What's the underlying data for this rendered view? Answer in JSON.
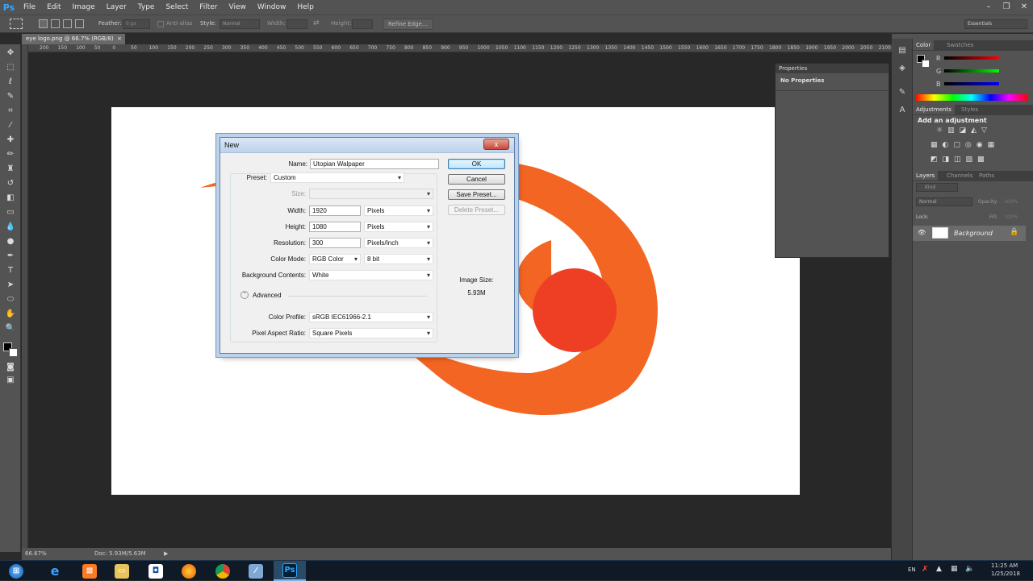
{
  "app": {
    "logo": "Ps",
    "window_buttons": [
      "–",
      "❐",
      "✕"
    ]
  },
  "menu": [
    "File",
    "Edit",
    "Image",
    "Layer",
    "Type",
    "Select",
    "Filter",
    "View",
    "Window",
    "Help"
  ],
  "options": {
    "feather_label": "Feather:",
    "feather_value": "0 px",
    "antialias_label": "Anti-alias",
    "style_label": "Style:",
    "style_value": "Normal",
    "width_label": "Width:",
    "height_label": "Height:",
    "refine_edge": "Refine Edge...",
    "workspace": "Essentials"
  },
  "document_tab": {
    "title": "eye logo.png @ 66.7% (RGB/8)",
    "close": "×"
  },
  "ruler_ticks": [
    "200",
    "150",
    "100",
    "50",
    "0",
    "50",
    "100",
    "150",
    "200",
    "250",
    "300",
    "350",
    "400",
    "450",
    "500",
    "550",
    "600",
    "650",
    "700",
    "750",
    "800",
    "850",
    "900",
    "950",
    "1000",
    "1050",
    "1100",
    "1150",
    "1200",
    "1250",
    "1300",
    "1350",
    "1400",
    "1450",
    "1500",
    "1550",
    "1600",
    "1650",
    "1700",
    "1750",
    "1800",
    "1850",
    "1900",
    "1950",
    "2000",
    "2050",
    "2100"
  ],
  "status": {
    "zoom": "66.67%",
    "doc": "Doc: 5.93M/5.63M"
  },
  "panels": {
    "color_tab": "Color",
    "swatches_tab": "Swatches",
    "channels": [
      "R",
      "G",
      "B"
    ],
    "adjustments_tab": "Adjustments",
    "styles_tab": "Styles",
    "add_adjustment": "Add an adjustment",
    "layers_tab": "Layers",
    "channels_tab": "Channels",
    "paths_tab": "Paths",
    "kind": "Kind",
    "blend": "Normal",
    "opacity_label": "Opacity:",
    "opacity_value": "100%",
    "lock_label": "Lock:",
    "fill_label": "Fill:",
    "fill_value": "100%",
    "layer_name": "Background"
  },
  "properties": {
    "title": "Properties",
    "body": "No Properties"
  },
  "dialog": {
    "title": "New",
    "close": "x",
    "name_label": "Name:",
    "name_value": "Utopian Walpaper",
    "preset_label": "Preset:",
    "preset_value": "Custom",
    "size_label": "Size:",
    "width_label": "Width:",
    "width_value": "1920",
    "width_unit": "Pixels",
    "height_label": "Height:",
    "height_value": "1080",
    "height_unit": "Pixels",
    "resolution_label": "Resolution:",
    "resolution_value": "300",
    "resolution_unit": "Pixels/Inch",
    "color_mode_label": "Color Mode:",
    "color_mode_value": "RGB Color",
    "bit_depth": "8 bit",
    "bg_label": "Background Contents:",
    "bg_value": "White",
    "advanced_label": "Advanced",
    "color_profile_label": "Color Profile:",
    "color_profile_value": "sRGB IEC61966-2.1",
    "pixel_aspect_label": "Pixel Aspect Ratio:",
    "pixel_aspect_value": "Square Pixels",
    "ok": "OK",
    "cancel": "Cancel",
    "save_preset": "Save Preset...",
    "delete_preset": "Delete Preset...",
    "image_size_label": "Image Size:",
    "image_size_value": "5.93M"
  },
  "taskbar": {
    "language": "EN",
    "time": "11:25 AM",
    "date": "1/25/2018"
  },
  "colors": {
    "logo_orange": "#f26522",
    "logo_red": "#ee3e23",
    "accent": "#31a8ff"
  }
}
